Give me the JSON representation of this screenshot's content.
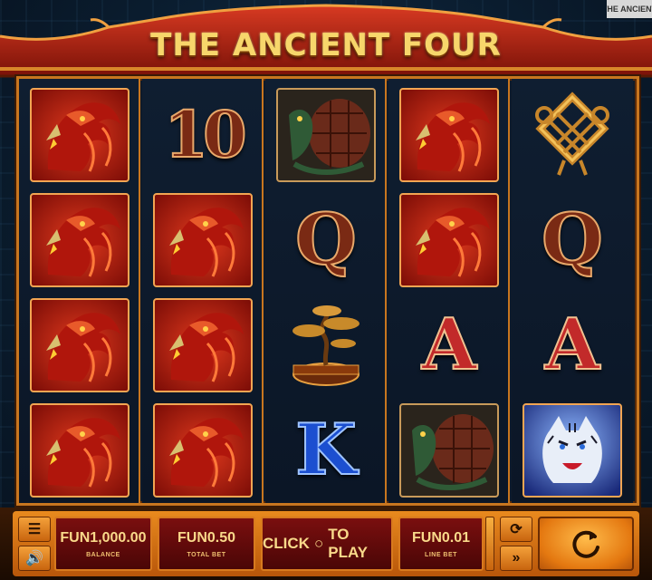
{
  "corner_tag": "THE ANCIENT",
  "title": "THE ANCIENT FOUR",
  "reels": [
    [
      "phoenix",
      "phoenix",
      "phoenix",
      "phoenix"
    ],
    [
      "10",
      "phoenix",
      "phoenix",
      "phoenix"
    ],
    [
      "turtle",
      "Q",
      "bonsai",
      "K"
    ],
    [
      "phoenix",
      "phoenix",
      "A",
      "turtle"
    ],
    [
      "knot",
      "Q",
      "A",
      "tiger"
    ]
  ],
  "symbols": {
    "ten": "10",
    "queen": "Q",
    "king": "K",
    "ace": "A"
  },
  "controls": {
    "menu_icon": "menu-icon",
    "sound_icon": "speaker-icon",
    "balance_value": "FUN1,000.00",
    "balance_label": "BALANCE",
    "total_bet_value": "FUN0.50",
    "total_bet_label": "TOTAL BET",
    "play_text_1": "CLICK",
    "play_text_2": "TO PLAY",
    "line_bet_value": "FUN0.01",
    "line_bet_label": "LINE BET",
    "autoplay_icon": "autoplay-icon",
    "fast_forward_icon": "fast-forward-icon",
    "spin_icon": "spin-icon"
  },
  "colors": {
    "frame_gold": "#c8761f",
    "accent_orange": "#e98a1e",
    "panel_red": "#7a0f0f",
    "text_gold": "#f9d98a"
  }
}
